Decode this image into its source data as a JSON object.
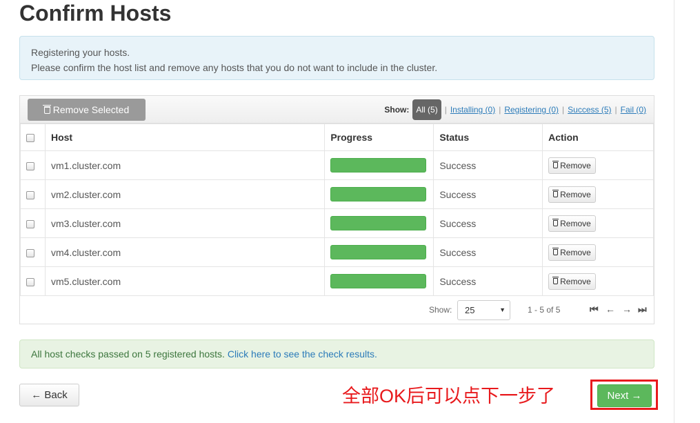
{
  "page": {
    "title": "Confirm Hosts"
  },
  "info_alert": {
    "line1": "Registering your hosts.",
    "line2": "Please confirm the host list and remove any hosts that you do not want to include in the cluster."
  },
  "toolbar": {
    "remove_selected_label": "Remove Selected",
    "show_label": "Show:",
    "filters": {
      "all": "All (5)",
      "installing": "Installing (0)",
      "registering": "Registering (0)",
      "success": "Success (5)",
      "fail": "Fail (0)"
    },
    "separator": "|"
  },
  "table": {
    "columns": {
      "host": "Host",
      "progress": "Progress",
      "status": "Status",
      "action": "Action"
    },
    "rows": [
      {
        "host": "vm1.cluster.com",
        "progress": 1.0,
        "status": "Success",
        "action": "Remove"
      },
      {
        "host": "vm2.cluster.com",
        "progress": 1.0,
        "status": "Success",
        "action": "Remove"
      },
      {
        "host": "vm3.cluster.com",
        "progress": 1.0,
        "status": "Success",
        "action": "Remove"
      },
      {
        "host": "vm4.cluster.com",
        "progress": 1.0,
        "status": "Success",
        "action": "Remove"
      },
      {
        "host": "vm5.cluster.com",
        "progress": 1.0,
        "status": "Success",
        "action": "Remove"
      }
    ]
  },
  "pager": {
    "show_label": "Show:",
    "page_size": "25",
    "range": "1 - 5 of 5"
  },
  "success_alert": {
    "text": "All host checks passed on 5 registered hosts.",
    "link": "Click here to see the check results."
  },
  "footer": {
    "back_label": "← Back",
    "next_label": "Next →",
    "annotation": "全部OK后可以点下一步了"
  },
  "colors": {
    "progress_bar": "#5cb85c",
    "status_success": "#3c9a3c",
    "link": "#2b7bb9",
    "annotation": "#e8191c"
  }
}
